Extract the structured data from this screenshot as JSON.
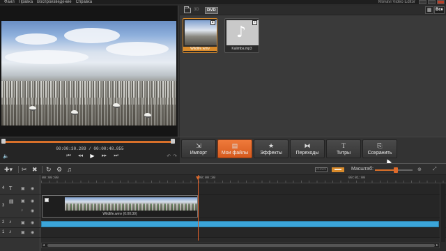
{
  "menu": {
    "items": [
      "Файл",
      "Правка",
      "Воспроизведение",
      "Справка"
    ],
    "app_title": "Movavi Video Editor"
  },
  "library": {
    "tags": {
      "three_d": "3D",
      "dvd": "DVD"
    },
    "filter_label": "Все",
    "clips": [
      {
        "label": "Wildlife.wmv",
        "kind": "video",
        "selected": true
      },
      {
        "label": "Kalimba.mp3",
        "kind": "audio",
        "selected": false
      }
    ]
  },
  "player": {
    "time_current": "00:00:30.289",
    "time_total": "00:00:48.055",
    "time_separator": "/",
    "progress_fraction": 0.63
  },
  "actions": [
    {
      "label": "Импорт",
      "icon": "import-icon",
      "active": false
    },
    {
      "label": "Мои файлы",
      "icon": "my-files-icon",
      "active": true
    },
    {
      "label": "Эффекты",
      "icon": "star-icon",
      "active": false
    },
    {
      "label": "Переходы",
      "icon": "transitions-icon",
      "active": false
    },
    {
      "label": "Титры",
      "icon": "titles-icon",
      "active": false
    },
    {
      "label": "Сохранить",
      "icon": "save-icon",
      "active": false
    }
  ],
  "timeline": {
    "zoom_label": "Масштаб:",
    "zoom_fraction": 0.55,
    "ruler": [
      "00:00:00",
      "00:00:30",
      "00:01:00"
    ],
    "tracks": [
      {
        "num": "4",
        "type": "titles"
      },
      {
        "num": "3",
        "type": "video"
      },
      {
        "num": "2",
        "type": "audio"
      },
      {
        "num": "1",
        "type": "audio"
      }
    ],
    "video_clip_title": "Wildlife.wmv (0:00:30)"
  },
  "colors": {
    "accent_orange": "#e0602a",
    "audio_blue": "#3ba5d9",
    "selected_outline": "#d98b2b"
  }
}
